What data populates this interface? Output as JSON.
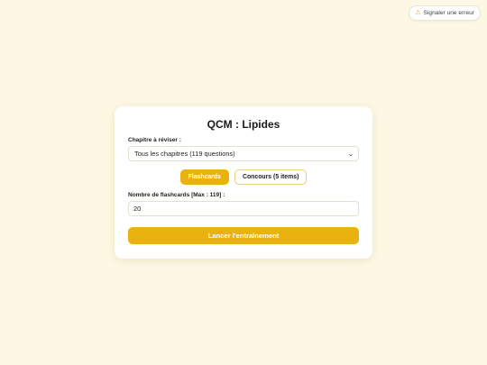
{
  "header": {
    "report_icon": "warning-icon",
    "report_label": "Signaler une erreur"
  },
  "quiz": {
    "title": "QCM : Lipides",
    "chapter_label": "Chapitre à réviser :",
    "chapter_selected": "Tous les chapitres (119 questions)",
    "modes": [
      {
        "label": "Flashcards",
        "active": true
      },
      {
        "label": "Concours (5 items)",
        "active": false
      }
    ],
    "count_label": "Nombre de flashcards [Max : 119] :",
    "count_value": "20",
    "launch_label": "Lancer l'entraînement"
  },
  "colors": {
    "background": "#fdf8e4",
    "accent": "#e9b20e",
    "card": "#ffffff"
  }
}
